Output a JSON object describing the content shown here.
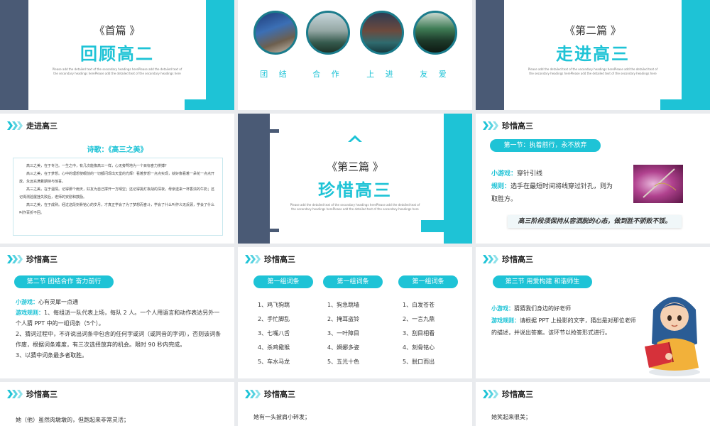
{
  "slides": {
    "cover1": {
      "sub": "《首篇 》",
      "title": "回顾高二",
      "small": "Please add the detailed text of the secondary headings herePlease add the detailed text of the secondary headings herePlease add the detailed text of the secondary headings here"
    },
    "photos": {
      "labels": [
        "团 结",
        "合 作",
        "上 进",
        "友 爱"
      ]
    },
    "cover2": {
      "sub": "《第二篇 》",
      "title": "走进高三",
      "small": "Please add the detailed text of the secondary headings herePlease add the detailed text of the secondary headings herePlease add the detailed text of the secondary headings here"
    },
    "poem": {
      "header": "走进高三",
      "title": "诗歌：《高三之美》",
      "paragraphs": [
        "高三之美，在于专注。一生之中，有几次能像高三一样，心无旁骛地为一个目标奋力拼搏?",
        "高三之美，在于梦想。心中的理想使眼前的一切都闪现出天堂的光辉！看着梦想一点点实现，就好像看着一朵花一点点开放，永远充满着期待与惊喜。",
        "高三之美，在于温情。记得那个雨天，好友为自己撑开一方晴空；还记得挑灯夜战的深夜，母亲送来一杯香浓的牛奶；还记得测验屡挫失败后，老师的安慰和鼓励。",
        "高三之美，在于成熟。经过这段刻骨铭心的岁月，才真正学会了为了梦想而奋斗，学会了什么叫作义无反顾，学会了什么叫作百折不回。"
      ]
    },
    "cover3": {
      "sub": "《第三篇 》",
      "title": "珍惜高三",
      "small": "Please add the detailed text of the secondary headings herePlease add the detailed text of the secondary headings herePlease add the detailed text of the secondary headings here"
    },
    "sec1": {
      "header": "珍惜高三",
      "pill": "第一节：执着前行，永不放弃",
      "game_label": "小游戏：",
      "game": "穿针引线",
      "rule_label": "规则：",
      "rule": "选手在最短时间将线穿过针孔，则为取胜方。",
      "quote": "高三阶段须保持从容洒脱的心态，做到胜不骄败不馁。"
    },
    "sec2": {
      "header": "珍惜高三",
      "pill": "第二节 团结合作 奋力前行",
      "game_label": "小游戏：",
      "game": "心有灵犀一点通",
      "rule_label": "游戏规则：",
      "rules": [
        "1、每组派一队代表上场，每队 2 人。一个人用语言和动作表达另外一个人猜 PPT 中的一组词条（5个）。",
        "2、猜词过程中，不许说出词条中包含的任何字或词（或同音的字词），否则该词条作废，根据词条难度，有三次选择放弃的机会。限时 90 秒内完成。",
        "3、以猜中词条最多者取胜。"
      ]
    },
    "words": {
      "header": "珍惜高三",
      "groups": [
        {
          "name": "第一组词条",
          "items": [
            "1、鸡飞狗跳",
            "2、手忙脚乱",
            "3、七嘴八舌",
            "4、杀鸡儆猴",
            "5、车水马龙"
          ]
        },
        {
          "name": "第一组词条",
          "items": [
            "1、狗急跳墙",
            "2、掩耳盗铃",
            "3、一叶障目",
            "4、婀娜多姿",
            "5、五光十色"
          ]
        },
        {
          "name": "第一组词条",
          "items": [
            "1、白发苍苍",
            "2、一言九鼎",
            "3、刮目相看",
            "4、刻骨铭心",
            "5、脱口而出"
          ]
        }
      ]
    },
    "sec3": {
      "header": "珍惜高三",
      "pill": "第三节 用爱构建  和谐师生",
      "game_label": "小游戏：",
      "game": "猜猜我们身边的好老师",
      "rule_label": "游戏规则：",
      "rule": "请根据 PPT 上投影的文字，猜出是对那位老师的描述，并说出答案。该环节以抢答形式进行。"
    },
    "r4a": {
      "header": "珍惜高三",
      "text": "她（他）虽然肉墩墩的，但跑起来非常灵活；"
    },
    "r4b": {
      "header": "珍惜高三",
      "text": "她有一头披肩小碎发；"
    },
    "r4c": {
      "header": "珍惜高三",
      "text": "她笑起来很美；"
    }
  }
}
